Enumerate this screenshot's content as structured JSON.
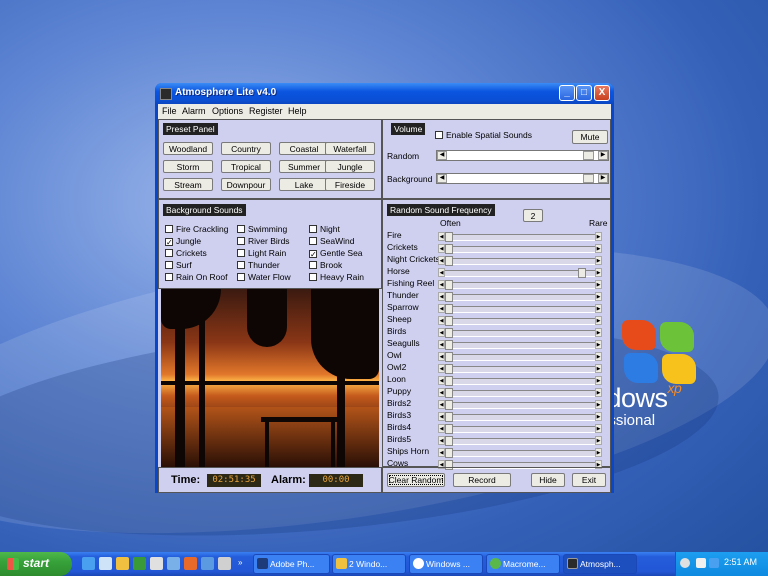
{
  "window": {
    "title": "Atmosphere Lite v4.0",
    "menu": [
      "File",
      "Alarm",
      "Options",
      "Register",
      "Help"
    ],
    "controls": {
      "minimize": "_",
      "maximize": "□",
      "close": "X"
    }
  },
  "preset_panel": {
    "title": "Preset Panel",
    "buttons": [
      "Woodland",
      "Country",
      "Coastal",
      "Waterfall",
      "Storm",
      "Tropical",
      "Summer",
      "Jungle",
      "Stream",
      "Downpour",
      "Lake",
      "Fireside"
    ]
  },
  "volume_panel": {
    "title": "Volume",
    "spatial_label": "Enable Spatial Sounds",
    "mute_label": "Mute",
    "random_label": "Random",
    "background_label": "Background",
    "random_level": 0.97,
    "background_level": 0.97
  },
  "background_sounds": {
    "title": "Background Sounds",
    "items": [
      {
        "label": "Fire Crackling",
        "checked": false
      },
      {
        "label": "Jungle",
        "checked": true
      },
      {
        "label": "Crickets",
        "checked": false
      },
      {
        "label": "Surf",
        "checked": false
      },
      {
        "label": "Rain On Roof",
        "checked": false
      },
      {
        "label": "Swimming",
        "checked": false
      },
      {
        "label": "River Birds",
        "checked": false
      },
      {
        "label": "Light Rain",
        "checked": false
      },
      {
        "label": "Thunder",
        "checked": false
      },
      {
        "label": "Water Flow",
        "checked": false
      },
      {
        "label": "Night",
        "checked": false
      },
      {
        "label": "SeaWind",
        "checked": false
      },
      {
        "label": "Gentle Sea",
        "checked": true
      },
      {
        "label": "Brook",
        "checked": false
      },
      {
        "label": "Heavy Rain",
        "checked": false
      }
    ]
  },
  "random_frequency": {
    "title": "Random Sound Frequency",
    "value": "2",
    "often_label": "Often",
    "rare_label": "Rare",
    "items": [
      {
        "label": "Fire",
        "level": 0.0
      },
      {
        "label": "Crickets",
        "level": 0.0
      },
      {
        "label": "Night Crickets",
        "level": 0.0
      },
      {
        "label": "Horse",
        "level": 0.94
      },
      {
        "label": "Fishing Reel",
        "level": 0.0
      },
      {
        "label": "Thunder",
        "level": 0.0
      },
      {
        "label": "Sparrow",
        "level": 0.0
      },
      {
        "label": "Sheep",
        "level": 0.0
      },
      {
        "label": "Birds",
        "level": 0.0
      },
      {
        "label": "Seagulls",
        "level": 0.0
      },
      {
        "label": "Owl",
        "level": 0.0
      },
      {
        "label": "Owl2",
        "level": 0.0
      },
      {
        "label": "Loon",
        "level": 0.0
      },
      {
        "label": "Puppy",
        "level": 0.0
      },
      {
        "label": "Birds2",
        "level": 0.0
      },
      {
        "label": "Birds3",
        "level": 0.0
      },
      {
        "label": "Birds4",
        "level": 0.0
      },
      {
        "label": "Birds5",
        "level": 0.0
      },
      {
        "label": "Ships Horn",
        "level": 0.0
      },
      {
        "label": "Cows",
        "level": 0.0
      }
    ]
  },
  "status": {
    "time_label": "Time:",
    "time_value": "02:51:35",
    "alarm_label": "Alarm:",
    "alarm_value": "00:00"
  },
  "bottom_buttons": {
    "clear_random": "Clear Random",
    "record": "Record",
    "hide": "Hide",
    "exit": "Exit"
  },
  "desktop": {
    "brand_text": "ndows",
    "brand_xp": "xp",
    "brand_sub": "essional"
  },
  "taskbar": {
    "start_label": "start",
    "tasks": [
      "Adobe Ph...",
      "2 Windo...",
      "Windows ...",
      "Macrome...",
      "Atmosph..."
    ],
    "clock": "2:51 AM"
  },
  "colors": {
    "titlebar": "#0b55e0",
    "client_bg": "#cfd0f0",
    "lcd_text": "#e8a33a",
    "taskbar": "#245ddb",
    "start_green": "#37a23a"
  }
}
